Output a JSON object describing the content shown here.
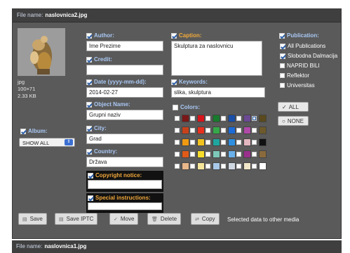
{
  "file": {
    "label": "File name:",
    "name": "naslovnica2.jpg"
  },
  "image_info": {
    "type": "jpg",
    "dimensions": "100×71",
    "size": "2.33 KB"
  },
  "album": {
    "label": "Album:",
    "selected": "SHOW ALL"
  },
  "fields": {
    "author": {
      "label": "Author:",
      "value": "Ime Prezime"
    },
    "credit": {
      "label": "Credit:",
      "value": ""
    },
    "date": {
      "label": "Date (yyyy-mm-dd):",
      "value": "2014-02-27"
    },
    "object_name": {
      "label": "Object Name:",
      "value": "Grupni naziv"
    },
    "city": {
      "label": "City:",
      "value": "Grad"
    },
    "country": {
      "label": "Country:",
      "value": "Država"
    },
    "copyright": {
      "label": "Copyright notice:",
      "value": ""
    },
    "special": {
      "label": "Special instructions:",
      "value": ""
    },
    "caption": {
      "label": "Caption:",
      "value": "Skulptura za naslovnicu"
    },
    "keywords": {
      "label": "Keywords:",
      "value": "slika, skulptura"
    }
  },
  "colors": {
    "label": "Colors:",
    "swatches": [
      [
        "#7a1717",
        "#d9151c",
        "#177a2c",
        "#1a4fa8",
        "#6b4a93",
        "#5a4a1e"
      ],
      [
        "#c7421a",
        "#e8301f",
        "#35a84a",
        "#1c6bd6",
        "#b04aa8",
        "#6d5a2a"
      ],
      [
        "#f09a12",
        "#f2c21e",
        "#1fa6a0",
        "#2e8fe0",
        "#e2b7c0",
        "#111111"
      ],
      [
        "#e05a18",
        "#f5dc2a",
        "#7dc8b8",
        "#6ab0ea",
        "#9a2f8c",
        "#8a6a3c"
      ],
      [
        "#e8b78a",
        "#f5e59a",
        "#a8c9e8",
        "#cfd8e2",
        "#f0e6c8",
        "#ffffff"
      ]
    ]
  },
  "publication": {
    "label": "Publication:",
    "items": [
      {
        "label": "All Publications",
        "checked": true
      },
      {
        "label": "Slobodna Dalmacija",
        "checked": true
      },
      {
        "label": "NAPRID BILI",
        "checked": false
      },
      {
        "label": "Reflektor",
        "checked": false
      },
      {
        "label": "Universitas",
        "checked": false
      }
    ],
    "all_label": "ALL",
    "none_label": "NONE"
  },
  "toolbar": {
    "save": "Save",
    "save_iptc": "Save IPTC",
    "move": "Move",
    "delete": "Delete",
    "copy": "Copy",
    "note": "Selected data to other media"
  },
  "next_file": {
    "label": "File name:",
    "name": "naslovnica1.jpg"
  },
  "accent": {
    "blue_label": "#a9c8f4",
    "orange_label": "#f2a93b",
    "panel": "#5a5a5a"
  }
}
